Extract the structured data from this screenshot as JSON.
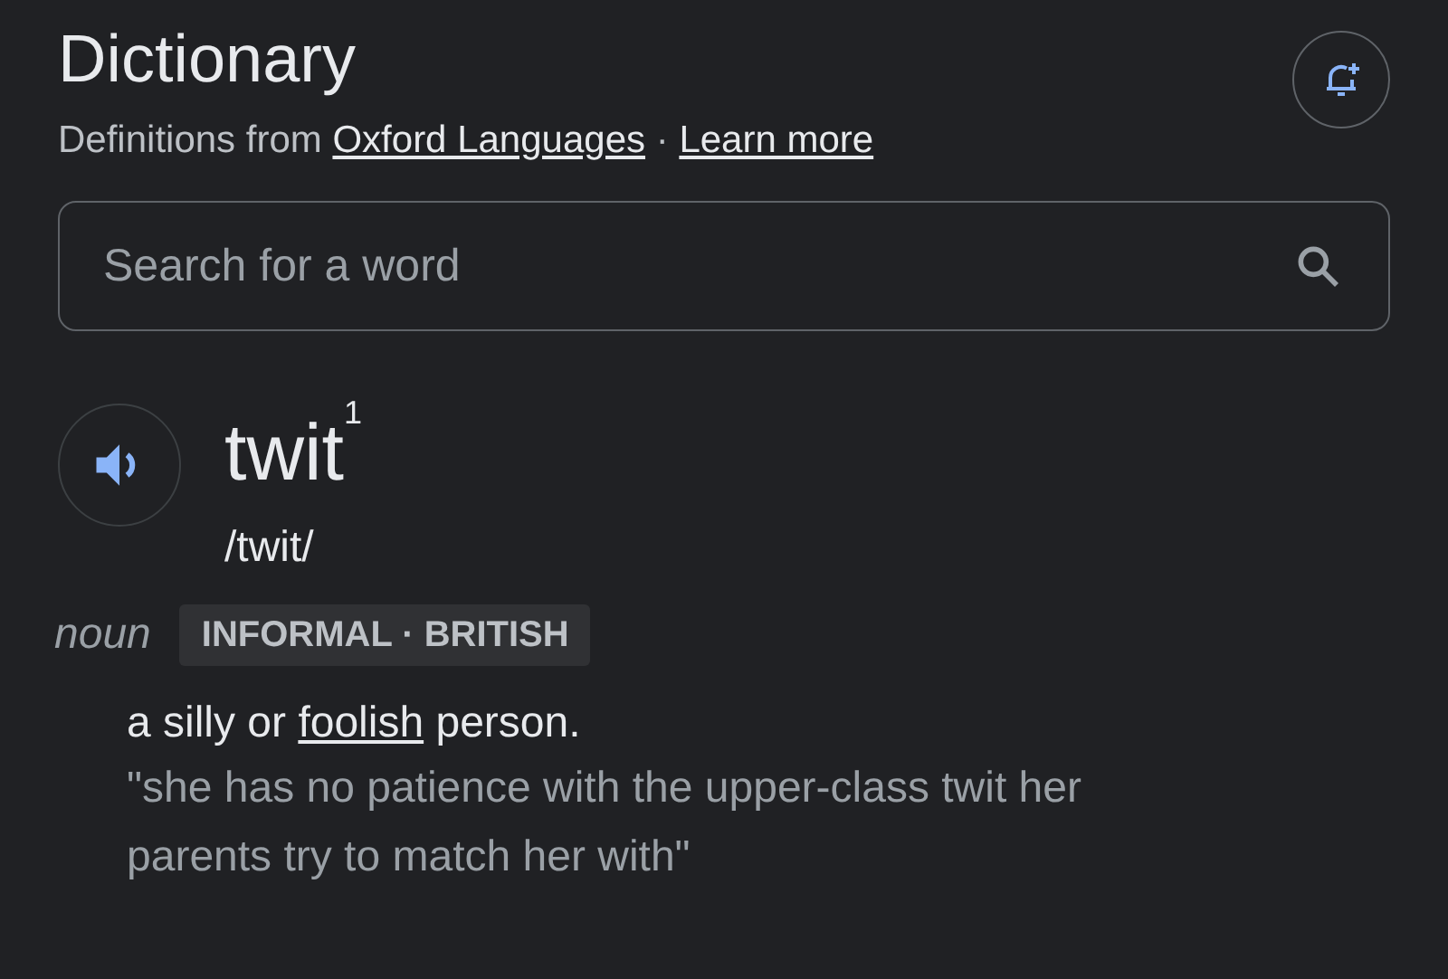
{
  "header": {
    "title": "Dictionary",
    "source": {
      "prefix": "Definitions from ",
      "link": "Oxford Languages",
      "separator": " · ",
      "learn_more": "Learn more"
    }
  },
  "search": {
    "placeholder": "Search for a word"
  },
  "entry": {
    "headword": "twit$^{1}$",
    "pronunciation": "/twit/",
    "part_of_speech": "noun",
    "label": "INFORMAL · BRITISH",
    "definition": {
      "before": "a silly or ",
      "link": "foolish",
      "after": " person."
    },
    "example": "\"she has no patience with the upper-class twit her parents try to match her with\""
  }
}
